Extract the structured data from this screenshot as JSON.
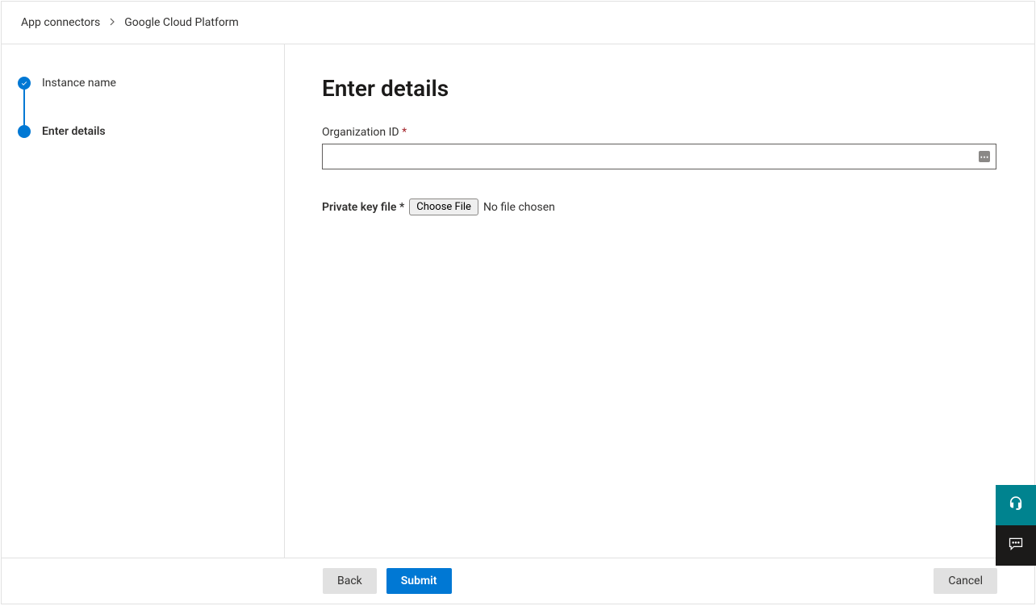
{
  "breadcrumb": {
    "root": "App connectors",
    "current": "Google Cloud Platform"
  },
  "steps": [
    {
      "label": "Instance name",
      "state": "complete"
    },
    {
      "label": "Enter details",
      "state": "current"
    }
  ],
  "main": {
    "title": "Enter details",
    "org_id_label": "Organization ID",
    "org_id_required": "*",
    "org_id_value": "",
    "private_key_label": "Private key file",
    "private_key_required": "*",
    "choose_file_label": "Choose File",
    "file_status": "No file chosen"
  },
  "footer": {
    "back": "Back",
    "submit": "Submit",
    "cancel": "Cancel"
  }
}
